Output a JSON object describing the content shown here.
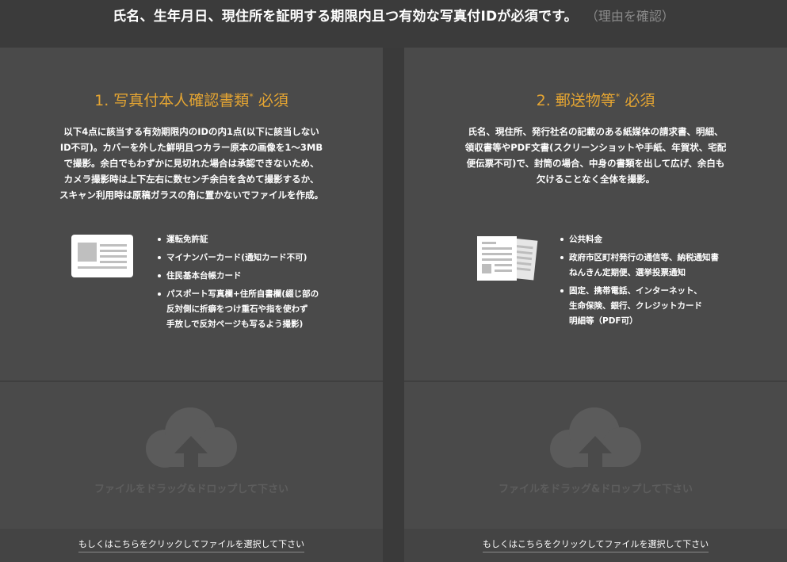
{
  "header": {
    "main_text": "氏名、生年月日、現住所を証明する期限内且つ有効な写真付IDが必須です。",
    "reason_link": "（理由を確認）"
  },
  "panels": [
    {
      "title": "1. 写真付本人確認書類",
      "required_mark": "*",
      "required_label": "必須",
      "description": "以下4点に該当する有効期限内のIDの内1点(以下に該当しないID不可)。カバーを外した鮮明且つカラー原本の画像を1～3MBで撮影。余白でもわずかに見切れた場合は承認できないため、カメラ撮影時は上下左右に数センチ余白を含めて撮影するか、スキャン利用時は原稿ガラスの角に置かないでファイルを作成。",
      "items": [
        "運転免許証",
        "マイナンバーカード(通知カード不可)",
        "住民基本台帳カード",
        "パスポート写真欄+住所自書欄(綴じ部の\n反対側に折癖をつけ重石や指を使わず\n手放しで反対ページも写るよう撮影)"
      ],
      "drop_text": "ファイルをドラッグ&ドロップして下さい",
      "select_text": "もしくはこちらをクリックしてファイルを選択して下さい"
    },
    {
      "title": "2. 郵送物等",
      "required_mark": "*",
      "required_label": "必須",
      "description": "氏名、現住所、発行社名の記載のある紙媒体の請求書、明細、領収書等やPDF文書(スクリーンショットや手紙、年賀状、宅配便伝票不可)で、封筒の場合、中身の書類を出して広げ、余白も欠けることなく全体を撮影。",
      "items": [
        "公共料金",
        "政府市区町村発行の通信等、納税通知書\nねんきん定期便、選挙投票通知",
        "固定、携帯電話、インターネット、\n生命保険、銀行、クレジットカード\n明細等（PDF可）"
      ],
      "drop_text": "ファイルをドラッグ&ドロップして下さい",
      "select_text": "もしくはこちらをクリックしてファイルを選択して下さい"
    }
  ],
  "colors": {
    "accent": "#e5a532",
    "panel_bg": "#4a4a4a",
    "page_bg": "#3a3a3a",
    "drop_icon": "#5b5b5b"
  }
}
